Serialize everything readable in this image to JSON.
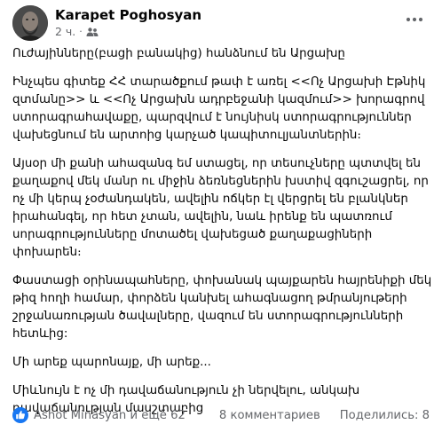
{
  "post": {
    "author": "Karapet Poghosyan",
    "time": "2 ч.",
    "separator": "·",
    "paragraphs": [
      "Ուժայինները(բացի բանակից) հանձնում են Արցախը",
      "Ինչպես գիտեք ՀՀ տարածքում թափ է առել <<Ոչ Արցախի Էթնիկ զտմանը>> և <<Ոչ Արցախն ադրբեջանի կազմում>> խորագրով ստորագրահավաքը, պարզվում է նույնիսկ ստորագրություններ վախեցնում են արտոից կարչած կապիտուլյանտներին։",
      "Այսօր մի քանի ահազանգ եմ ստացել, որ տեսուչները պտտվել են քաղաքով մեկ մանր ու միջին ձեռնեցներին խստիվ զգուշացրել, որ ոչ մի կերպ չօժանդակեն, ավելին ոճկեր էլ վերցրել են բլանկներ իրահանգել, որ հետ չտան, ավելին, նաև իրենք են պատռում սորագրությունները մոտածել վախեցած քաղաքացիների փոխարեն։",
      "Փաստացի օրինապահները, փոխանակ պայքարեն հայրենիքի մեկ թիզ հողի համար, փորձեն կանխել ահագնացող թմրանյութերի շրջանառության ծավալները, վազում են ստորագրությունների հետևից:",
      "Մի արեք պարոնայք, մի արեք...",
      "Միևնույն է ոչ մի դավաճանություն չի ներվելու, անկախ դավաճանության մասշտաբից"
    ]
  },
  "footer": {
    "reactions_text": "Ashot Minasyan и ещё 62",
    "comments": "8 комментариев",
    "shares": "Поделились: 8"
  },
  "colors": {
    "text": "#050505",
    "secondary": "#65676b",
    "like_blue": "#1877f2"
  },
  "icons": {
    "privacy": "friends-icon",
    "more": "more-dots-icon",
    "reaction": "like-icon"
  }
}
